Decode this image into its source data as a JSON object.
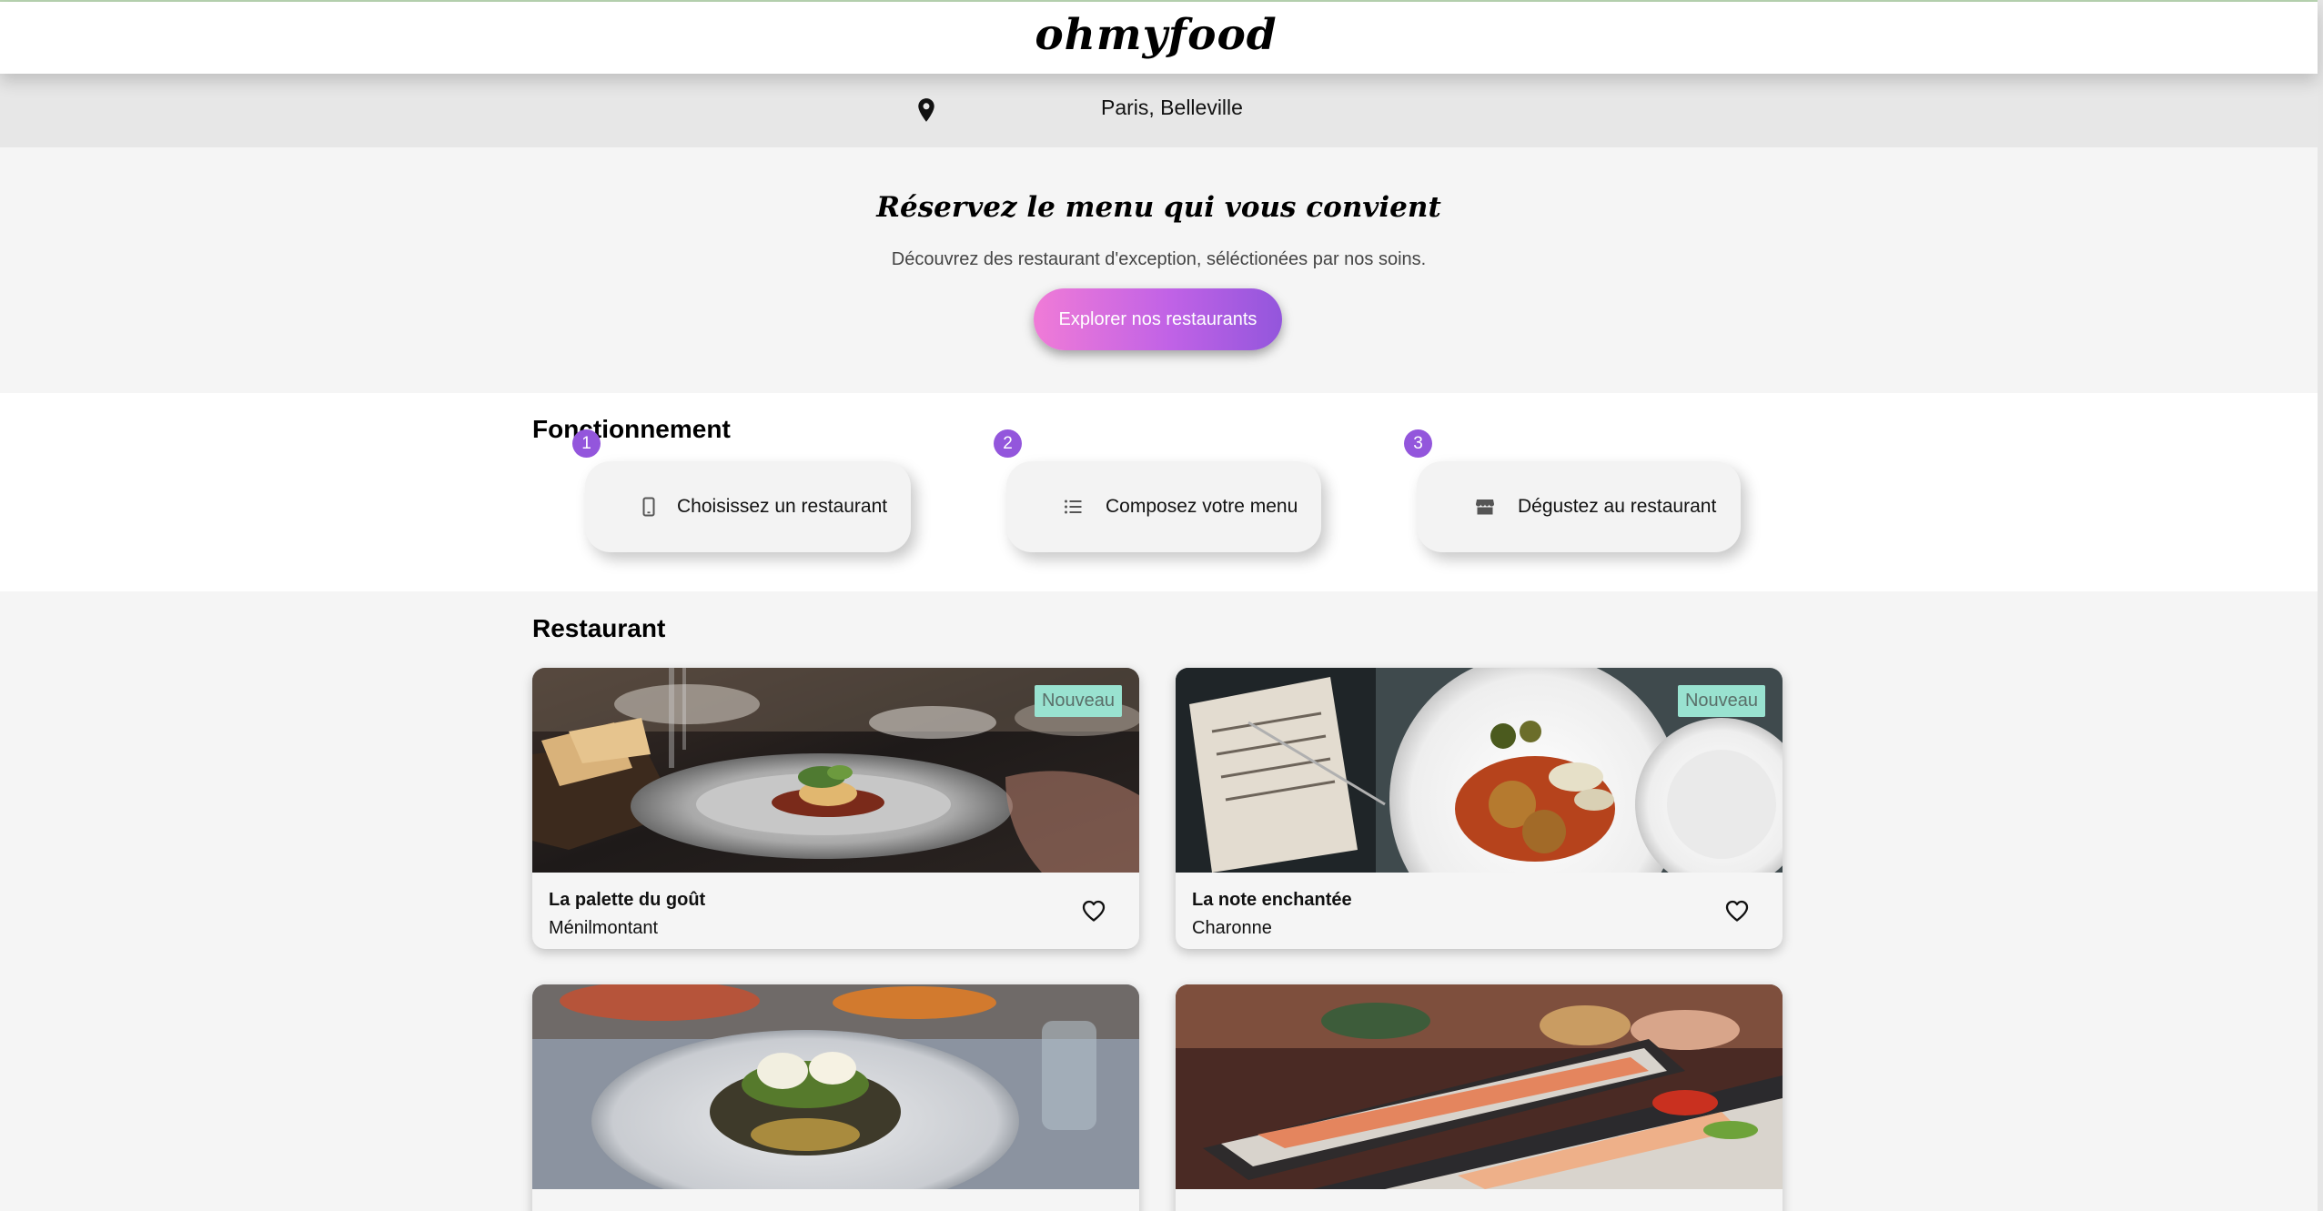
{
  "header": {
    "logo": "ohmyfood"
  },
  "location": {
    "icon": "location-pin-icon",
    "text": "Paris, Belleville"
  },
  "hero": {
    "title": "Réservez le menu qui vous convient",
    "subtitle": "Découvrez des restaurant d'exception, séléctionées par nos soins.",
    "button_label": "Explorer nos restaurants",
    "button_gradient": [
      "#f07bd7",
      "#9356dc"
    ]
  },
  "howto": {
    "title": "Fonctionnement",
    "steps": [
      {
        "number": "1",
        "icon": "smartphone-icon",
        "label": "Choisissez un restaurant"
      },
      {
        "number": "2",
        "icon": "list-icon",
        "label": "Composez votre menu"
      },
      {
        "number": "3",
        "icon": "store-icon",
        "label": "Dégustez au restaurant"
      }
    ],
    "accent_color": "#9356dc"
  },
  "restaurants": {
    "title": "Restaurant",
    "badge_color": "#99e2d0",
    "items": [
      {
        "name": "La palette du goût",
        "area": "Ménilmontant",
        "badge": "Nouveau",
        "favorite_icon": "heart-outline-icon"
      },
      {
        "name": "La note enchantée",
        "area": "Charonne",
        "badge": "Nouveau",
        "favorite_icon": "heart-outline-icon"
      },
      {
        "name": "",
        "area": "",
        "badge": "",
        "favorite_icon": ""
      },
      {
        "name": "",
        "area": "",
        "badge": "",
        "favorite_icon": ""
      }
    ]
  }
}
